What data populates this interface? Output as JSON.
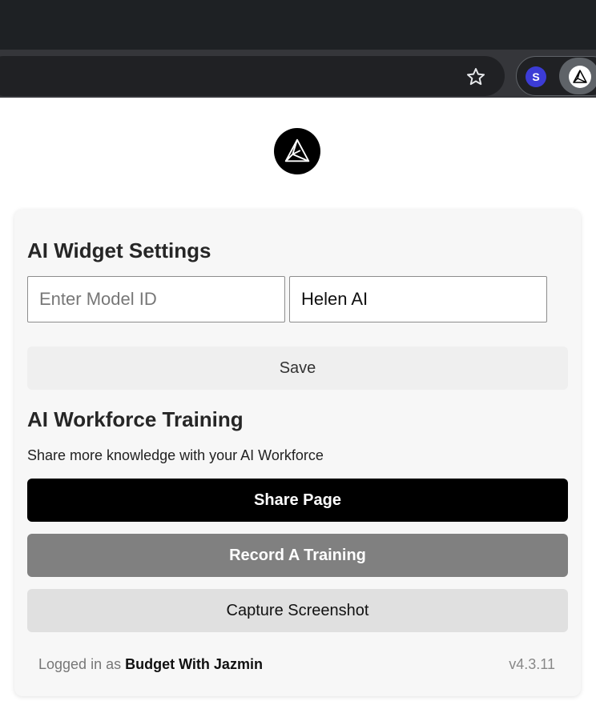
{
  "browser": {
    "extension_s_letter": "S"
  },
  "settings": {
    "title": "AI Widget Settings",
    "model_id_placeholder": "Enter Model ID",
    "model_id_value": "",
    "name_value": "Helen AI",
    "save_label": "Save"
  },
  "training": {
    "title": "AI Workforce Training",
    "description": "Share more knowledge with your AI Workforce",
    "share_label": "Share Page",
    "record_label": "Record A Training",
    "capture_label": "Capture Screenshot"
  },
  "footer": {
    "logged_in_prefix": "Logged in as",
    "user_name": "Budget With Jazmin",
    "version": "v4.3.11"
  },
  "colors": {
    "primary": "#000000",
    "secondary": "#808080",
    "card_bg": "#f7f7f7"
  },
  "icons": [
    "star-icon",
    "extension-s-icon",
    "ai-logo-icon"
  ]
}
